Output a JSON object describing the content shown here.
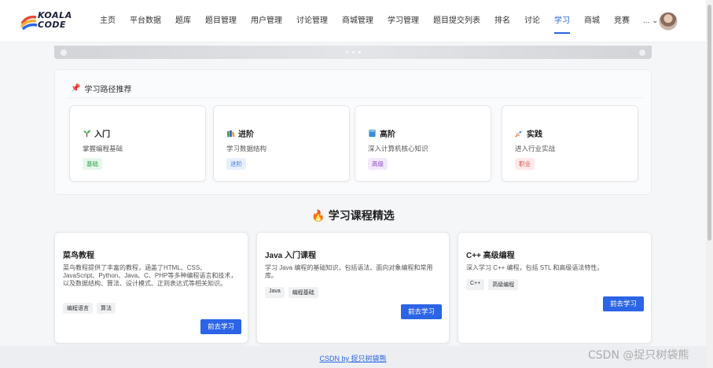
{
  "header": {
    "logo_line1": "KOALA",
    "logo_line2": "CODE",
    "nav": [
      "主页",
      "平台数据",
      "题库",
      "题目管理",
      "用户管理",
      "讨论管理",
      "商城管理",
      "学习管理",
      "题目提交列表",
      "排名",
      "讨论",
      "学习",
      "商城",
      "竞赛"
    ],
    "active_nav": "学习",
    "more_label": "...",
    "more_icon": "chevron-down-icon"
  },
  "path_section": {
    "title": "学习路径推荐",
    "icon": "pin-icon",
    "cards": [
      {
        "title": "入门",
        "desc": "掌握编程基础",
        "tag": "基础",
        "icon": "sprout-icon",
        "tag_color": "#2f9e44",
        "tag_bg": "#e6f7ea"
      },
      {
        "title": "进阶",
        "desc": "学习数据结构",
        "tag": "进阶",
        "icon": "books-icon",
        "tag_color": "#3b7ddd",
        "tag_bg": "#e7f0fc"
      },
      {
        "title": "高阶",
        "desc": "深入计算机核心知识",
        "tag": "高级",
        "icon": "book-icon",
        "tag_color": "#8a47c9",
        "tag_bg": "#f1e8fb"
      },
      {
        "title": "实践",
        "desc": "进入行业实战",
        "tag": "职业",
        "icon": "rocket-icon",
        "tag_color": "#d9534f",
        "tag_bg": "#fdeaea"
      }
    ]
  },
  "courses_section": {
    "title": "学习课程精选",
    "icon": "fire-icon",
    "courses": [
      {
        "title": "菜鸟教程",
        "desc": "菜鸟教程提供了丰富的教程，涵盖了HTML、CSS、JavaScript、Python、Java、C、PHP等多种编程语言和技术，以及数据结构、算法、设计模式、正则表达式等相关知识。",
        "tags": [
          "编程语言",
          "算法"
        ],
        "button": "前去学习"
      },
      {
        "title": "Java 入门课程",
        "desc": "学习 Java 编程的基础知识，包括语法、面向对象编程和常用库。",
        "tags": [
          "Java",
          "编程基础"
        ],
        "button": "前去学习"
      },
      {
        "title": "C++ 高级编程",
        "desc": "深入学习 C++ 编程，包括 STL 和高级语法特性。",
        "tags": [
          "C++",
          "高级编程"
        ],
        "button": "前去学习"
      }
    ]
  },
  "footer": {
    "link": "CSDN by 捉只树袋熊"
  },
  "watermark": "CSDN @捉只树袋熊",
  "colors": {
    "accent": "#2b64e6"
  }
}
